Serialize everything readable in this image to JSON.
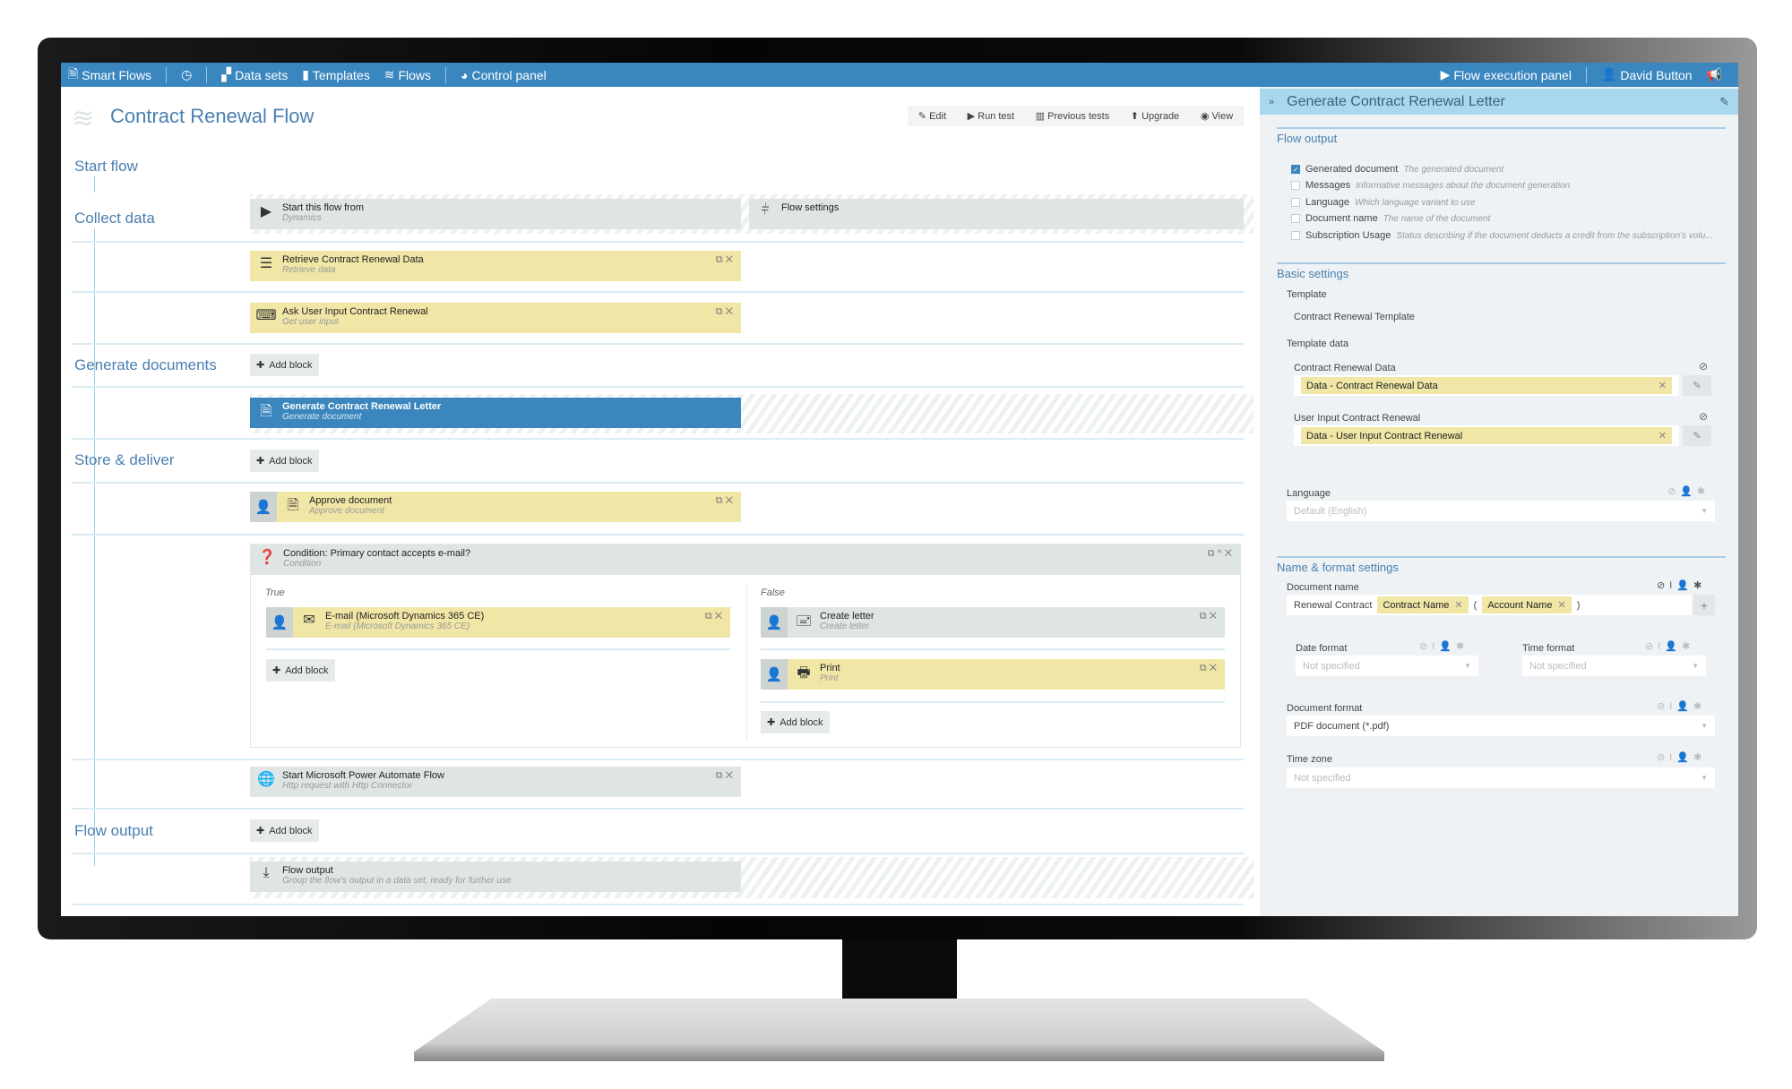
{
  "nav": {
    "app": "Smart Flows",
    "items": [
      "Data sets",
      "Templates",
      "Flows",
      "Control panel"
    ],
    "right": [
      "Flow execution panel",
      "David Button"
    ]
  },
  "page": {
    "title": "Contract Renewal Flow",
    "toolbar": [
      "Edit",
      "Run test",
      "Previous tests",
      "Upgrade",
      "View"
    ]
  },
  "sections": [
    "Start flow",
    "Collect data",
    "Generate documents",
    "Store & deliver",
    "Flow output"
  ],
  "blocks": {
    "start": {
      "title": "Start this flow from",
      "sub": "Dynamics"
    },
    "settings": {
      "title": "Flow settings"
    },
    "retrieve": {
      "title": "Retrieve Contract Renewal Data",
      "sub": "Retrieve data"
    },
    "ask": {
      "title": "Ask User Input Contract Renewal",
      "sub": "Get user input"
    },
    "generate": {
      "title": "Generate Contract Renewal Letter",
      "sub": "Generate document"
    },
    "approve": {
      "title": "Approve document",
      "sub": "Approve document"
    },
    "condition": {
      "title": "Condition: Primary contact accepts e-mail?",
      "sub": "Condition",
      "true_label": "True",
      "false_label": "False"
    },
    "email": {
      "title": "E-mail (Microsoft Dynamics 365 CE)",
      "sub": "E-mail (Microsoft Dynamics 365 CE)"
    },
    "letter": {
      "title": "Create letter",
      "sub": "Create letter"
    },
    "print": {
      "title": "Print",
      "sub": "Print"
    },
    "automate": {
      "title": "Start Microsoft Power Automate Flow",
      "sub": "Http request with Http Connector"
    },
    "output": {
      "title": "Flow output",
      "sub": "Group the flow's output in a data set, ready for further use"
    }
  },
  "add_block": "Add block",
  "panel": {
    "title": "Generate Contract Renewal Letter",
    "flow_output": {
      "heading": "Flow output",
      "items": [
        {
          "label": "Generated document",
          "hint": "The generated document",
          "checked": true
        },
        {
          "label": "Messages",
          "hint": "Informative messages about the document generation",
          "checked": false
        },
        {
          "label": "Language",
          "hint": "Which language variant to use",
          "checked": false
        },
        {
          "label": "Document name",
          "hint": "The name of the document",
          "checked": false
        },
        {
          "label": "Subscription Usage",
          "hint": "Status describing if the document deducts a credit from the subscription's volu...",
          "checked": false
        }
      ]
    },
    "basic": {
      "heading": "Basic settings",
      "template_label": "Template",
      "template_value": "Contract Renewal Template",
      "template_data": "Template data",
      "crd_label": "Contract Renewal Data",
      "crd_value": "Data - Contract Renewal Data",
      "uicr_label": "User Input Contract Renewal",
      "uicr_value": "Data - User Input Contract Renewal",
      "language_label": "Language",
      "language_placeholder": "Default (English)"
    },
    "name_format": {
      "heading": "Name & format settings",
      "docname_label": "Document name",
      "docname_text": "Renewal Contract",
      "docname_chip1": "Contract Name",
      "docname_paren_open": "(",
      "docname_chip2": "Account Name",
      "docname_paren_close": ")",
      "date_label": "Date format",
      "date_value": "Not specified",
      "time_label": "Time format",
      "time_value": "Not specified",
      "docformat_label": "Document format",
      "docformat_value": "PDF document (*.pdf)",
      "tz_label": "Time zone",
      "tz_value": "Not specified"
    }
  },
  "colors": {
    "topbar": "#3a87c0",
    "block_yellow": "#f0e6a6",
    "block_selected": "#3a86bd",
    "panel_header": "#a9d8ee"
  }
}
